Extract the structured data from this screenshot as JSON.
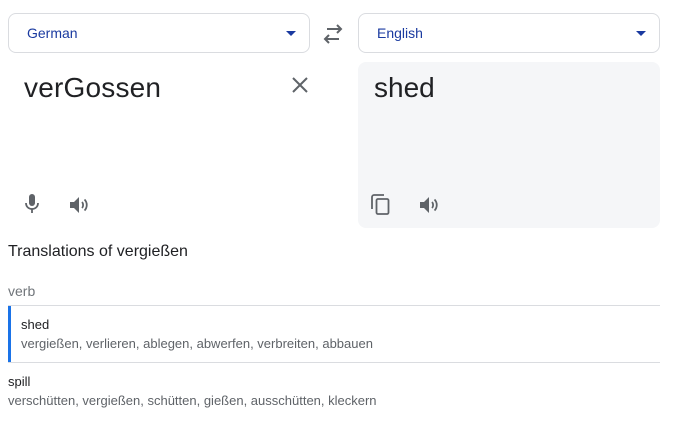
{
  "languages": {
    "source": "German",
    "target": "English"
  },
  "source_text": "verGossen",
  "target_text": "shed",
  "translations": {
    "title": "Translations of vergießen",
    "part_of_speech": "verb",
    "entries": [
      {
        "word": "shed",
        "synonyms": "vergießen, verlieren, ablegen, abwerfen, verbreiten, abbauen"
      },
      {
        "word": "spill",
        "synonyms": "verschütten, vergießen, schütten, gießen, ausschütten, kleckern"
      }
    ]
  },
  "icons": {
    "swap": "swap-arrows-icon",
    "clear": "close-icon",
    "mic": "microphone-icon",
    "speaker": "speaker-icon",
    "copy": "copy-icon",
    "dropdown": "caret-down-icon"
  },
  "colors": {
    "accent": "#1a73e8",
    "link": "#1a3aa0",
    "icon": "#5f6368",
    "panel_bg": "#f5f6f8"
  }
}
